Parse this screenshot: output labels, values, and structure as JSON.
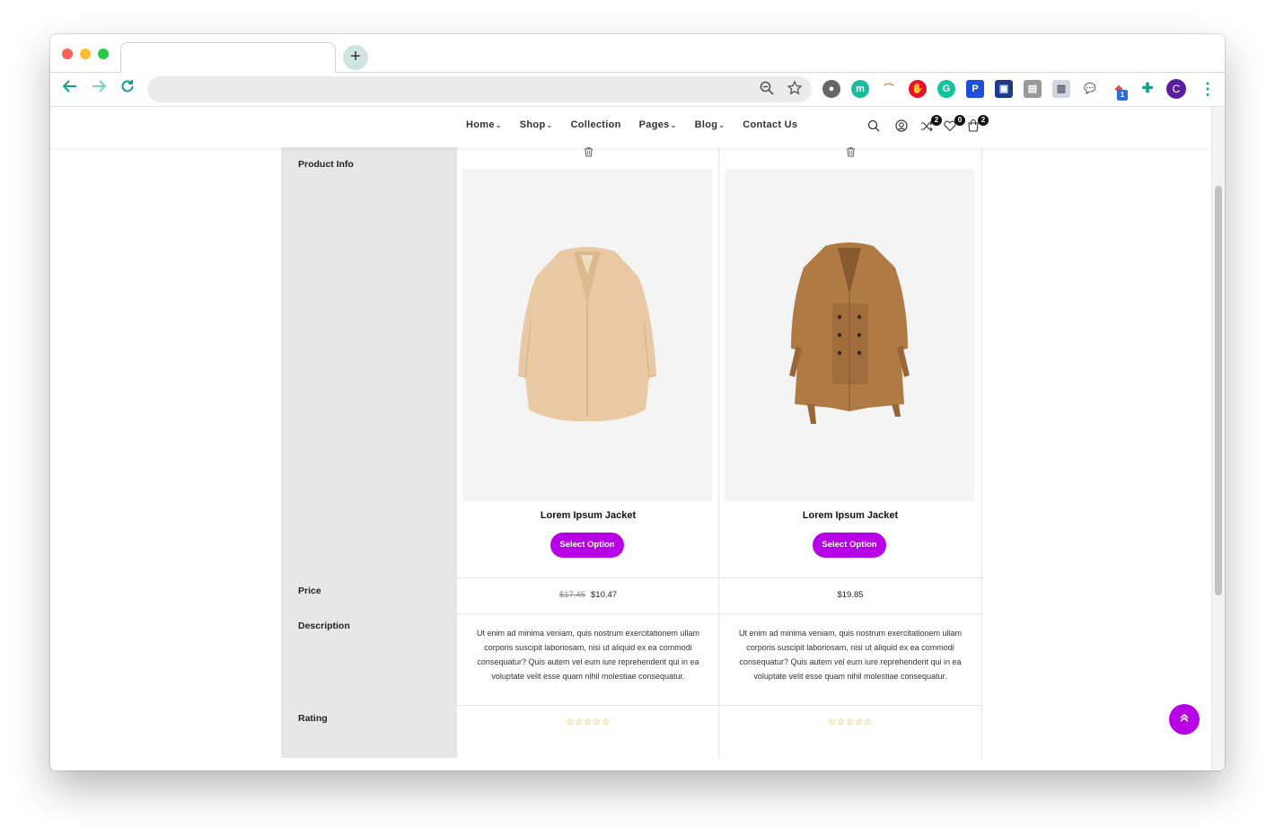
{
  "browser": {
    "new_tab_symbol": "+",
    "back_icon": "arrow-left-icon",
    "forward_icon": "arrow-right-icon",
    "reload_icon": "reload-icon",
    "profile_initial": "C",
    "extension_badge": "1"
  },
  "nav": {
    "items": [
      {
        "label": "Home",
        "has_dropdown": true
      },
      {
        "label": "Shop",
        "has_dropdown": true
      },
      {
        "label": "Collection",
        "has_dropdown": false
      },
      {
        "label": "Pages",
        "has_dropdown": true
      },
      {
        "label": "Blog",
        "has_dropdown": true
      },
      {
        "label": "Contact Us",
        "has_dropdown": false
      }
    ],
    "caret": "⌄",
    "compare_count": "2",
    "wishlist_count": "0",
    "cart_count": "2"
  },
  "compare": {
    "labels": {
      "product_info": "Product Info",
      "price": "Price",
      "description": "Description",
      "rating": "Rating"
    },
    "products": [
      {
        "name": "Lorem Ipsum Jacket",
        "button": "Select Option",
        "old_price": "$17.45",
        "price": "$10.47",
        "description": "Ut enim ad minima veniam, quis nostrum exercitationem ullam corporis suscipit laboriosam, nisi ut aliquid ex ea commodi consequatur? Quis autem vel eum iure reprehenderit qui in ea voluptate velit esse quam nihil molestiae consequatur.",
        "stars": "☆☆☆☆☆",
        "image": "beige-fleece-coat"
      },
      {
        "name": "Lorem Ipsum Jacket",
        "button": "Select Option",
        "old_price": "",
        "price": "$19.85",
        "description": "Ut enim ad minima veniam, quis nostrum exercitationem ullam corporis suscipit laboriosam, nisi ut aliquid ex ea commodi consequatur? Quis autem vel eum iure reprehenderit qui in ea voluptate velit esse quam nihil molestiae consequatur.",
        "stars": "☆☆☆☆☆",
        "image": "brown-trench-coat"
      }
    ]
  },
  "colors": {
    "accent": "#b800e6",
    "label_column": "#e7e7e7",
    "image_bg": "#f4f4f4",
    "star": "#f0a500"
  },
  "scroll_to_top_icon": "double-chevron-up-icon"
}
